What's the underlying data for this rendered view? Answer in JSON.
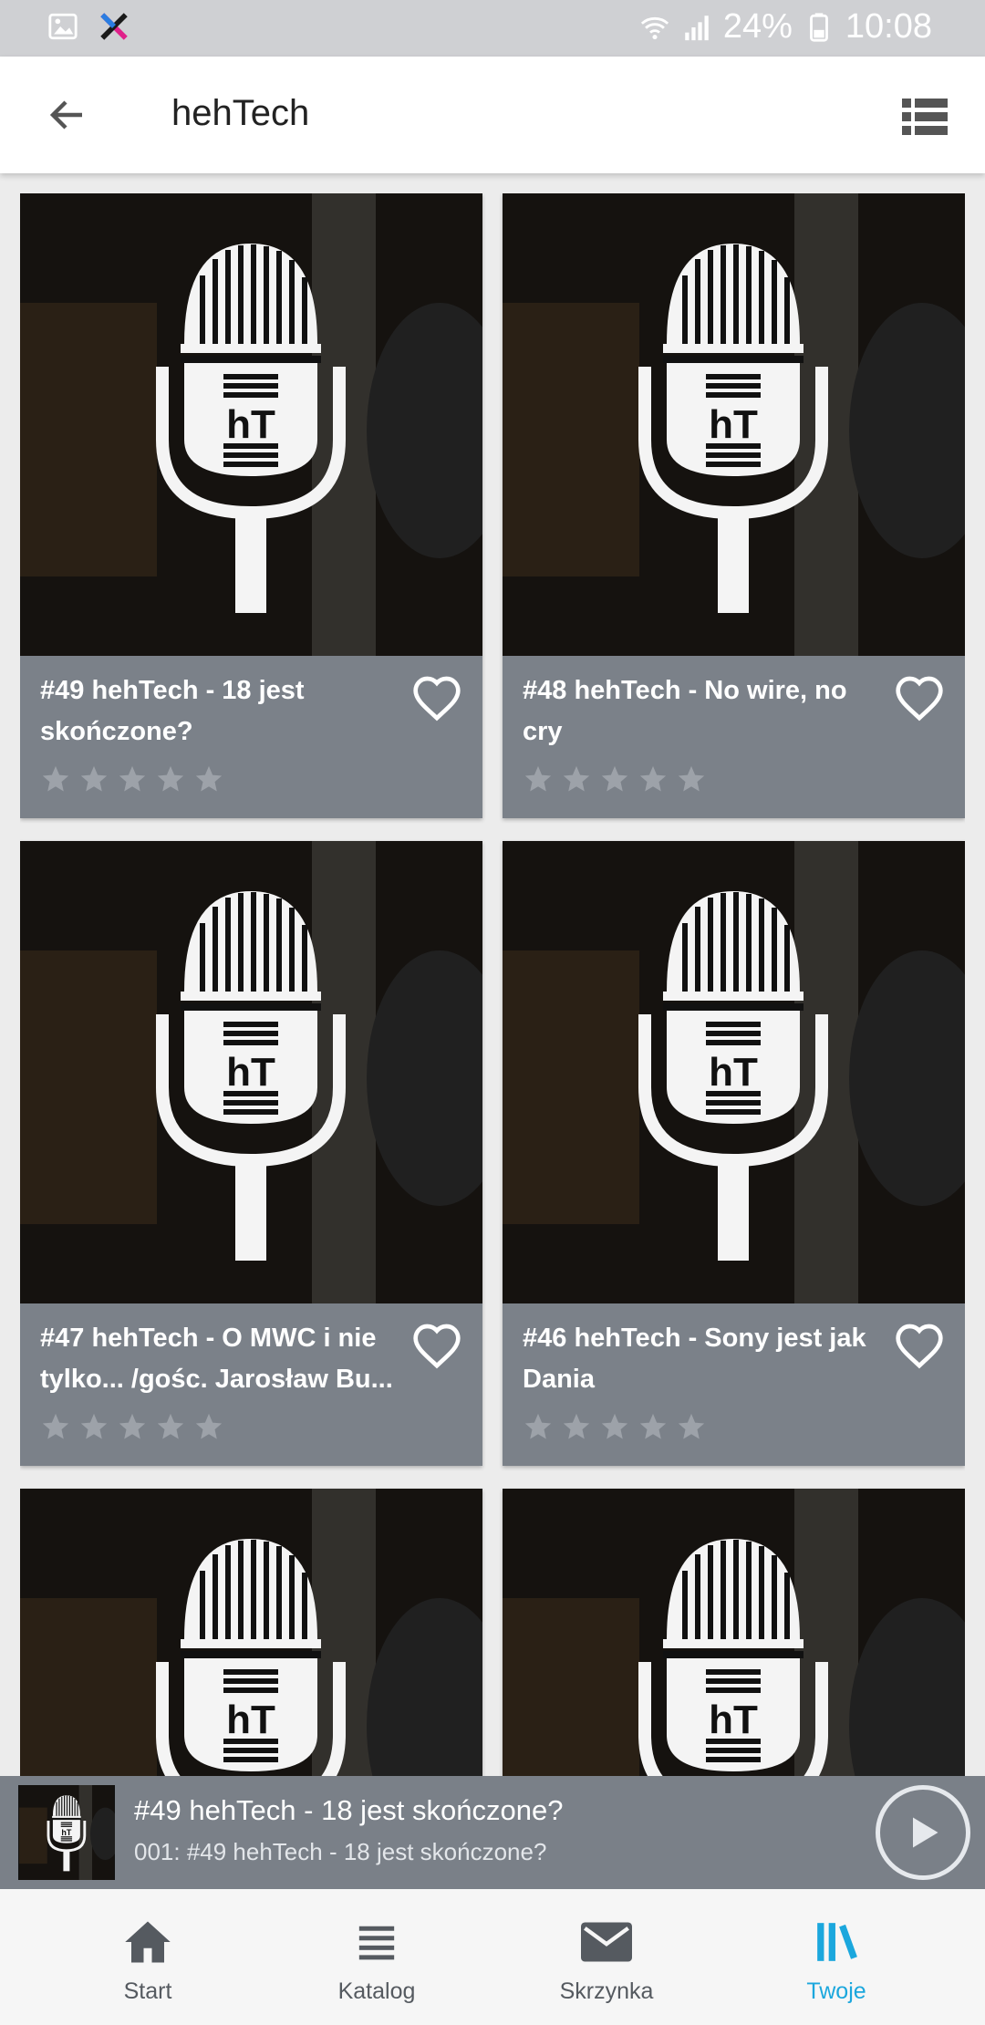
{
  "status_bar": {
    "battery": "24%",
    "time": "10:08",
    "icons": [
      "gallery-icon",
      "x-app-icon",
      "wifi-icon",
      "signal-icon",
      "battery-icon"
    ]
  },
  "app_bar": {
    "title": "hehTech",
    "back_icon": "arrow-left-icon",
    "view_icon": "list-view-icon"
  },
  "episodes": [
    {
      "title": "#49 hehTech - 18 jest skończone?",
      "rating": 0,
      "favorite": false
    },
    {
      "title": "#48 hehTech - No wire, no cry",
      "rating": 0,
      "favorite": false
    },
    {
      "title": "#47 hehTech - O MWC i nie tylko... /gośc. Jarosław Bu...",
      "rating": 0,
      "favorite": false
    },
    {
      "title": "#46 hehTech - Sony jest jak Dania",
      "rating": 0,
      "favorite": false
    },
    {
      "title": "",
      "rating": 0,
      "favorite": false
    },
    {
      "title": "",
      "rating": 0,
      "favorite": false
    }
  ],
  "player": {
    "title": "#49 hehTech - 18 jest skończone?",
    "subtitle": "001: #49 hehTech - 18 jest skończone?",
    "play_icon": "play-icon"
  },
  "bottom_nav": {
    "items": [
      {
        "label": "Start",
        "icon": "home-icon",
        "active": false
      },
      {
        "label": "Katalog",
        "icon": "list-icon",
        "active": false
      },
      {
        "label": "Skrzynka",
        "icon": "mail-icon",
        "active": false
      },
      {
        "label": "Twoje",
        "icon": "library-icon",
        "active": true
      }
    ]
  },
  "colors": {
    "accent": "#1ba7dd",
    "card_footer": "#7b8189",
    "status_bar": "#cfd0d3"
  }
}
